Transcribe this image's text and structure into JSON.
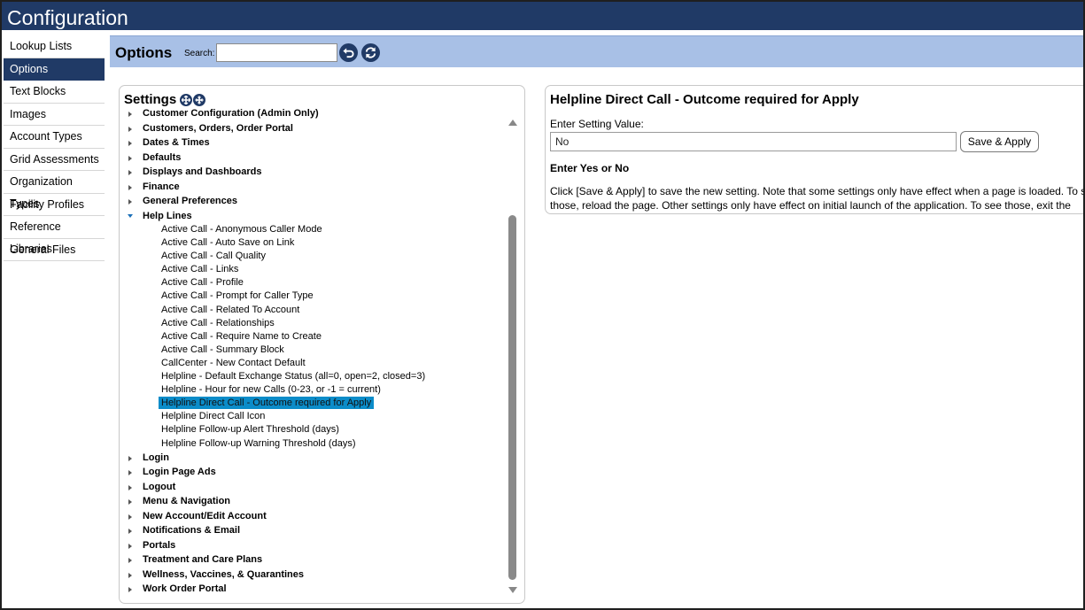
{
  "window": {
    "title": "Configuration"
  },
  "sidebar": {
    "items": [
      {
        "label": "Lookup Lists",
        "active": false
      },
      {
        "label": "Options",
        "active": true
      },
      {
        "label": "Text Blocks",
        "active": false
      },
      {
        "label": "Images",
        "active": false
      },
      {
        "label": "Account Types",
        "active": false
      },
      {
        "label": "Grid Assessments",
        "active": false
      },
      {
        "label": "Organization Types",
        "active": false
      },
      {
        "label": "Facility Profiles",
        "active": false
      },
      {
        "label": "Reference Libraries",
        "active": false
      },
      {
        "label": "General Files",
        "active": false
      }
    ]
  },
  "options_bar": {
    "title": "Options",
    "search_label": "Search:",
    "search_value": ""
  },
  "settings": {
    "title": "Settings",
    "tree": [
      {
        "type": "cat",
        "label": "Customer Configuration (Admin Only)",
        "open": false
      },
      {
        "type": "cat",
        "label": "Customers, Orders, Order Portal",
        "open": false
      },
      {
        "type": "cat",
        "label": "Dates & Times",
        "open": false
      },
      {
        "type": "cat",
        "label": "Defaults",
        "open": false
      },
      {
        "type": "cat",
        "label": "Displays and Dashboards",
        "open": false
      },
      {
        "type": "cat",
        "label": "Finance",
        "open": false
      },
      {
        "type": "cat",
        "label": "General Preferences",
        "open": false
      },
      {
        "type": "cat",
        "label": "Help Lines",
        "open": true
      },
      {
        "type": "leaf",
        "label": "Active Call - Anonymous Caller Mode"
      },
      {
        "type": "leaf",
        "label": "Active Call - Auto Save on Link"
      },
      {
        "type": "leaf",
        "label": "Active Call - Call Quality"
      },
      {
        "type": "leaf",
        "label": "Active Call - Links"
      },
      {
        "type": "leaf",
        "label": "Active Call - Profile"
      },
      {
        "type": "leaf",
        "label": "Active Call - Prompt for Caller Type"
      },
      {
        "type": "leaf",
        "label": "Active Call - Related To Account"
      },
      {
        "type": "leaf",
        "label": "Active Call - Relationships"
      },
      {
        "type": "leaf",
        "label": "Active Call - Require Name to Create"
      },
      {
        "type": "leaf",
        "label": "Active Call - Summary Block"
      },
      {
        "type": "leaf",
        "label": "CallCenter - New Contact Default"
      },
      {
        "type": "leaf",
        "label": "Helpline - Default Exchange Status (all=0, open=2, closed=3)"
      },
      {
        "type": "leaf",
        "label": "Helpline - Hour for new Calls (0-23, or -1 = current)"
      },
      {
        "type": "leaf",
        "label": "Helpline Direct Call - Outcome required for Apply",
        "selected": true
      },
      {
        "type": "leaf",
        "label": "Helpline Direct Call Icon"
      },
      {
        "type": "leaf",
        "label": "Helpline Follow-up Alert Threshold (days)"
      },
      {
        "type": "leaf",
        "label": "Helpline Follow-up Warning Threshold (days)"
      },
      {
        "type": "cat",
        "label": "Login",
        "open": false
      },
      {
        "type": "cat",
        "label": "Login Page Ads",
        "open": false
      },
      {
        "type": "cat",
        "label": "Logout",
        "open": false
      },
      {
        "type": "cat",
        "label": "Menu & Navigation",
        "open": false
      },
      {
        "type": "cat",
        "label": "New Account/Edit Account",
        "open": false
      },
      {
        "type": "cat",
        "label": "Notifications & Email",
        "open": false
      },
      {
        "type": "cat",
        "label": "Portals",
        "open": false
      },
      {
        "type": "cat",
        "label": "Treatment and Care Plans",
        "open": false
      },
      {
        "type": "cat",
        "label": "Wellness, Vaccines, & Quarantines",
        "open": false
      },
      {
        "type": "cat",
        "label": "Work Order Portal",
        "open": false
      }
    ]
  },
  "detail": {
    "title": "Helpline Direct Call - Outcome required for Apply",
    "value_label": "Enter Setting Value:",
    "value": "No",
    "save_label": "Save & Apply",
    "hint": "Enter Yes or No",
    "description": "Click [Save & Apply] to save the new setting. Note that some settings only have effect when a page is loaded. To see those, reload the page. Other settings only have effect on initial launch of the application. To see those, exit the application, close the browser, and restart."
  },
  "icons": {
    "back": "undo-arrow-icon",
    "refresh": "refresh-icon",
    "expand_all": "expand-all-icon",
    "collapse_all": "collapse-all-icon"
  },
  "colors": {
    "header_bg": "#203a66",
    "options_bar_bg": "#a8c0e6",
    "selection": "#0b8cc9"
  }
}
